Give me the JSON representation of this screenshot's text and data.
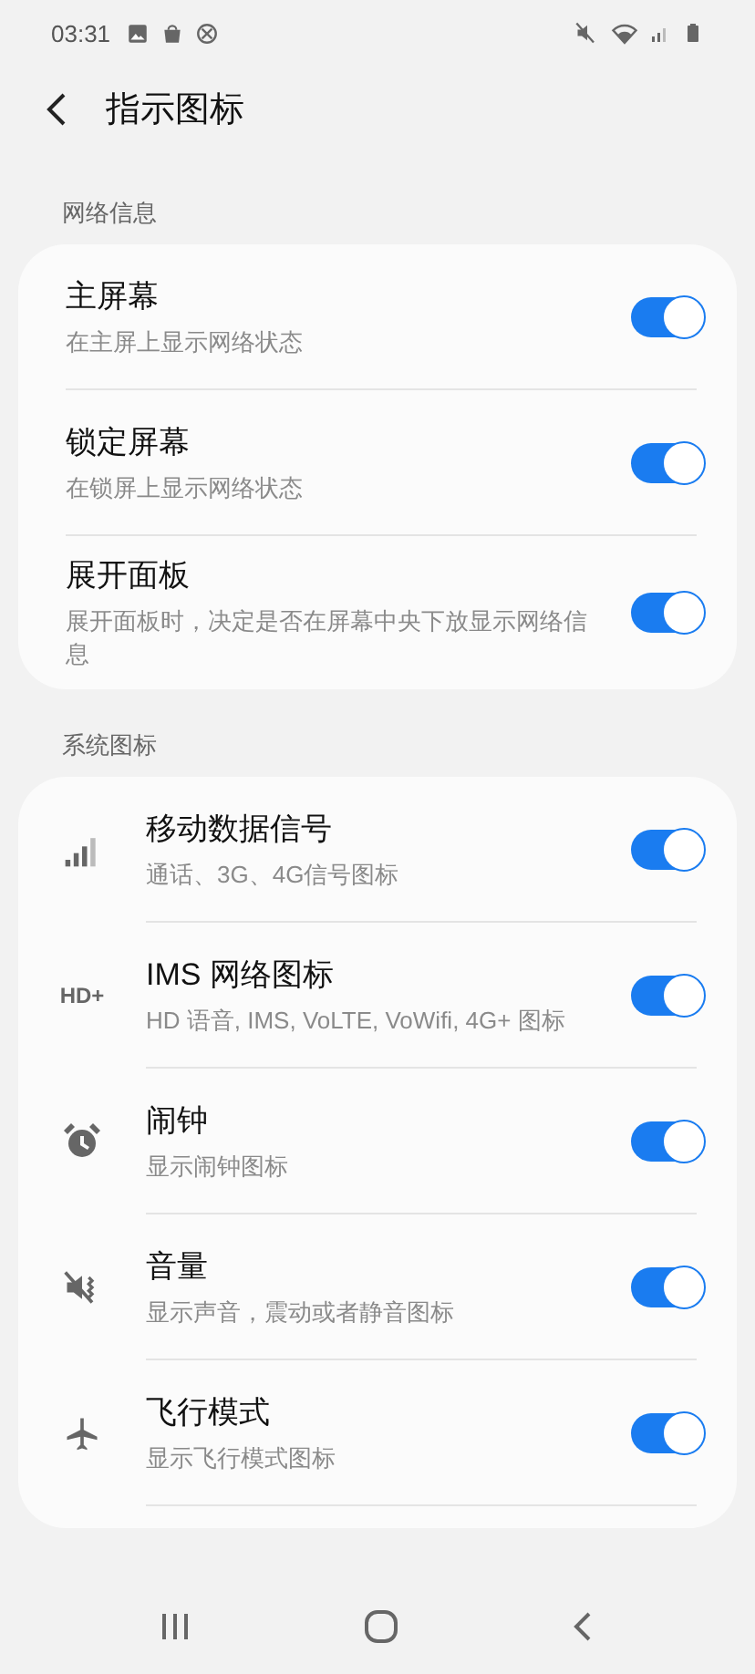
{
  "status_bar": {
    "time": "03:31"
  },
  "header": {
    "title": "指示图标"
  },
  "sections": [
    {
      "title": "网络信息",
      "items": [
        {
          "title": "主屏幕",
          "subtitle": "在主屏上显示网络状态",
          "on": true
        },
        {
          "title": "锁定屏幕",
          "subtitle": "在锁屏上显示网络状态",
          "on": true
        },
        {
          "title": "展开面板",
          "subtitle": "展开面板时，决定是否在屏幕中央下放显示网络信息",
          "on": true
        }
      ]
    },
    {
      "title": "系统图标",
      "items": [
        {
          "title": "移动数据信号",
          "subtitle": "通话、3G、4G信号图标",
          "on": true
        },
        {
          "title": "IMS 网络图标",
          "subtitle": "HD 语音, IMS, VoLTE, VoWifi, 4G+ 图标",
          "on": true,
          "icon_text": "HD+"
        },
        {
          "title": "闹钟",
          "subtitle": "显示闹钟图标",
          "on": true
        },
        {
          "title": "音量",
          "subtitle": "显示声音，震动或者静音图标",
          "on": true
        },
        {
          "title": "飞行模式",
          "subtitle": "显示飞行模式图标",
          "on": true
        }
      ]
    }
  ]
}
